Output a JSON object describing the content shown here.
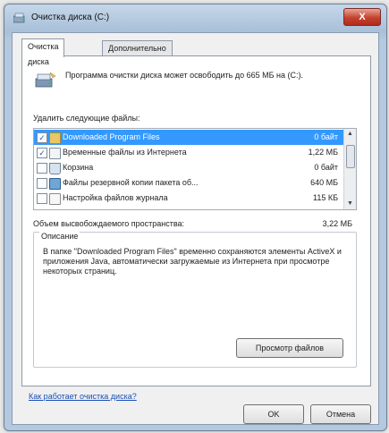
{
  "window": {
    "title": "Очистка диска  (C:)",
    "close_label": "X"
  },
  "tabs": [
    {
      "label": "Очистка диска"
    },
    {
      "label": "Дополнительно"
    }
  ],
  "header": {
    "text": "Программа очистки диска может освободить до 665 МБ на (C:)."
  },
  "files": {
    "label": "Удалить следующие файлы:",
    "items": [
      {
        "name": "Downloaded Program Files",
        "size": "0 байт",
        "checked": true,
        "selected": true,
        "icon": "folder-icon"
      },
      {
        "name": "Временные файлы из Интернета",
        "size": "1,22 МБ",
        "checked": true,
        "selected": false,
        "icon": "internet-files-icon"
      },
      {
        "name": "Корзина",
        "size": "0 байт",
        "checked": false,
        "selected": false,
        "icon": "recycle-bin-icon"
      },
      {
        "name": "Файлы резервной копии пакета об...",
        "size": "640 МБ",
        "checked": false,
        "selected": false,
        "icon": "backup-files-icon"
      },
      {
        "name": "Настройка файлов журнала",
        "size": "115 КБ",
        "checked": false,
        "selected": false,
        "icon": "log-files-icon"
      }
    ]
  },
  "freed": {
    "label": "Объем высвобождаемого пространства:",
    "value": "3,22 МБ"
  },
  "description": {
    "legend": "Описание",
    "text": "В папке \"Downloaded Program Files\" временно сохраняются элементы ActiveX и приложения Java, автоматически загружаемые из Интернета при просмотре некоторых страниц."
  },
  "buttons": {
    "view_files": "Просмотр файлов",
    "ok": "OK",
    "cancel": "Отмена"
  },
  "help_link": "Как работает очистка диска?",
  "colors": {
    "selection": "#3399ff",
    "link": "#1a4fb8",
    "close_button": "#c4422f"
  }
}
